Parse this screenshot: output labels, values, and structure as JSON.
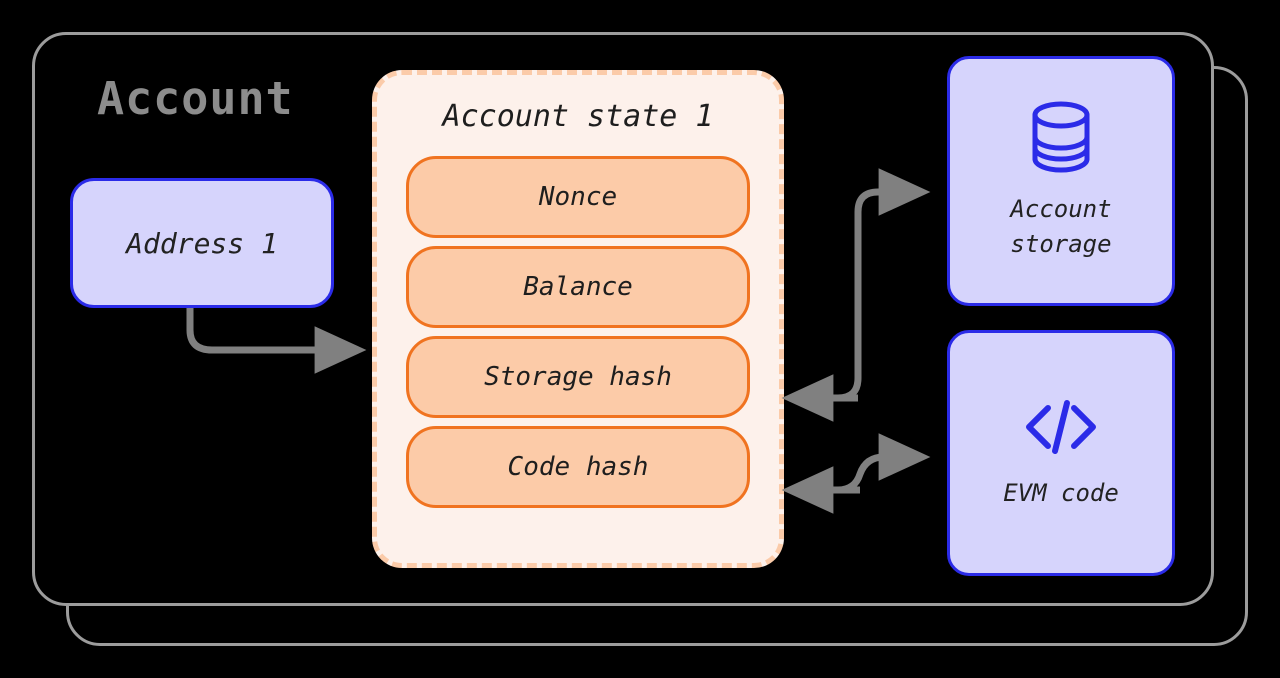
{
  "diagram": {
    "title": "Account",
    "title_color": "#8c8c8c",
    "background_color": "#000000",
    "frame_color": "#9c9c9c",
    "connector_color": "#808080",
    "accent_blue": "#2B2BE8",
    "accent_blue_fill": "#D6D4FC",
    "accent_orange": "#F07320",
    "accent_orange_fill": "#FCCBA8",
    "panel_fill": "#FDF1EB",
    "panel_border": "#FBCBA9"
  },
  "address_node": {
    "label": "Address 1"
  },
  "account_state": {
    "title": "Account state 1",
    "fields": [
      {
        "label": "Nonce"
      },
      {
        "label": "Balance"
      },
      {
        "label": "Storage hash"
      },
      {
        "label": "Code hash"
      }
    ]
  },
  "external_nodes": [
    {
      "icon": "database-icon",
      "label": "Account\nstorage"
    },
    {
      "icon": "code-brackets-icon",
      "label": "EVM code"
    }
  ],
  "connectors": [
    {
      "name": "address-to-account-state",
      "direction": "right"
    },
    {
      "name": "storage-hash-to-account-storage",
      "direction": "right"
    },
    {
      "name": "account-storage-to-storage-hash",
      "direction": "left"
    },
    {
      "name": "code-hash-to-evm-code",
      "direction": "right"
    },
    {
      "name": "evm-code-to-code-hash",
      "direction": "left"
    }
  ]
}
